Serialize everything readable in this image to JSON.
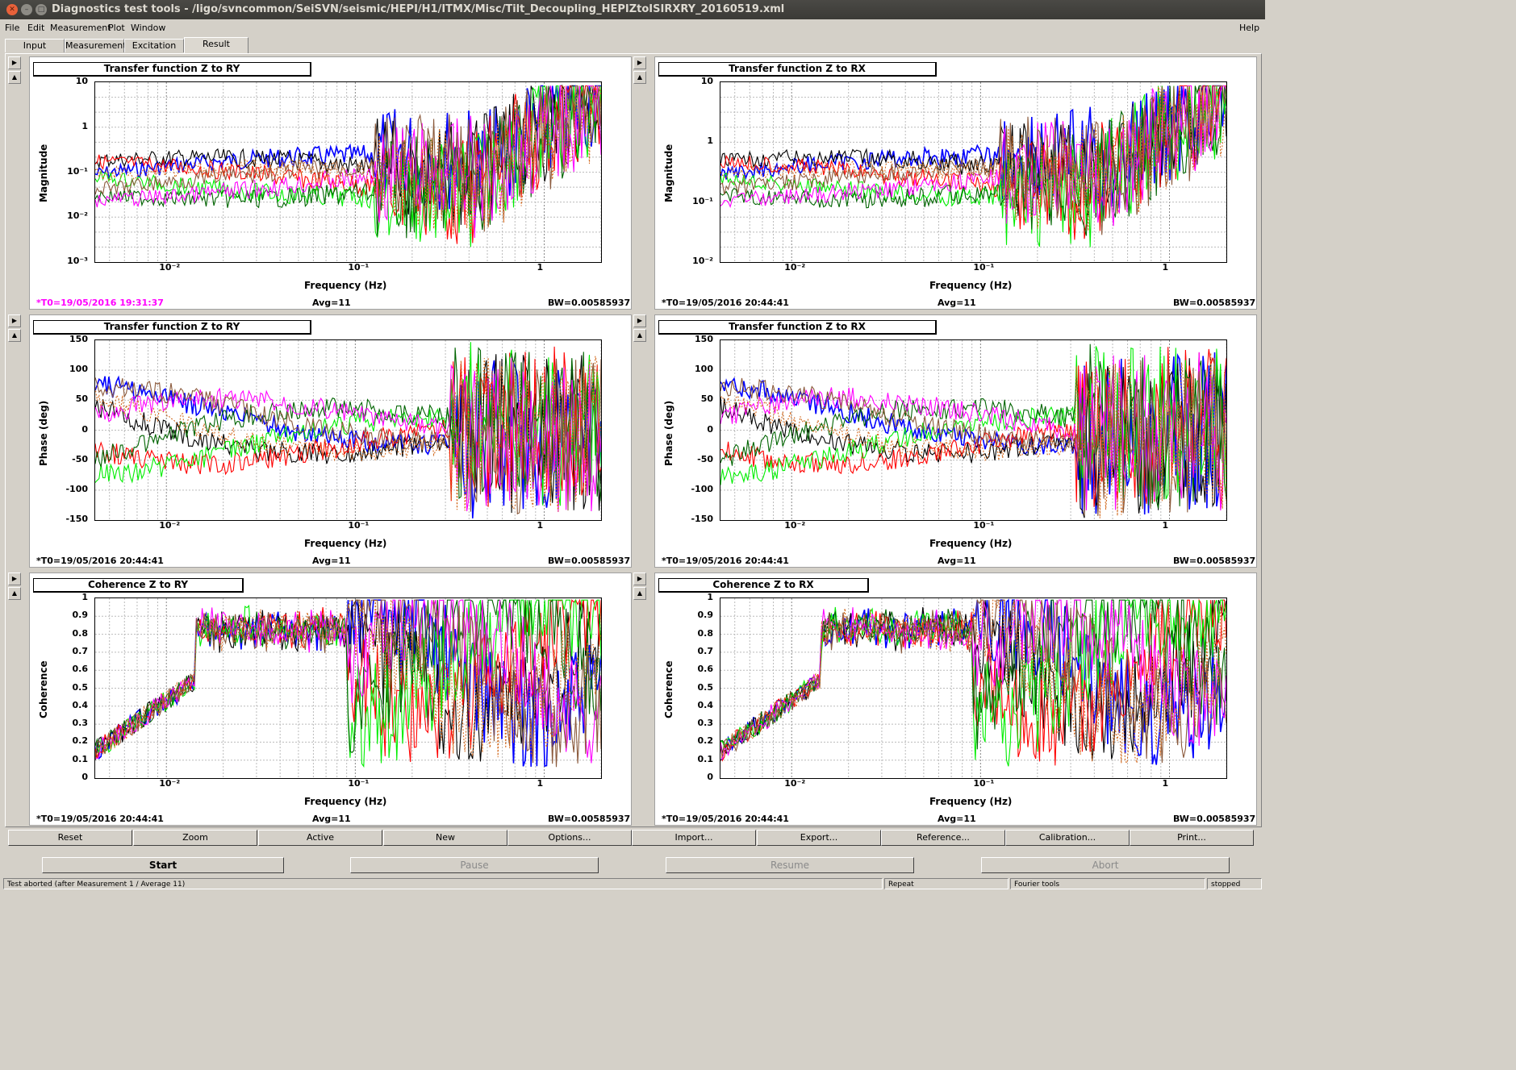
{
  "window": {
    "title": "Diagnostics test tools - /ligo/svncommon/SeiSVN/seismic/HEPI/H1/ITMX/Misc/Tilt_Decoupling_HEPIZtoISIRXRY_20160519.xml"
  },
  "menu": {
    "items": [
      "File",
      "Edit",
      "Measurement",
      "Plot",
      "Window"
    ],
    "help": "Help"
  },
  "tabs": [
    "Input",
    "Measurement",
    "Excitation",
    "Result"
  ],
  "colors": [
    "#0000ff",
    "#000000",
    "#ff0000",
    "#00ee00",
    "#006400",
    "#ff00ff",
    "#8b5a3c",
    "#d2691e"
  ],
  "panels": [
    {
      "title": "Transfer function Z to RY",
      "ylabel": "Magnitude",
      "xlabel": "Frequency (Hz)",
      "yticks": [
        "10",
        "1",
        "10⁻¹",
        "10⁻²",
        "10⁻³"
      ],
      "xticks": [
        "10⁻²",
        "10⁻¹",
        "1"
      ],
      "t0": "*T0=19/05/2016 19:31:37",
      "avg": "Avg=11",
      "bw": "BW=0.00585937"
    },
    {
      "title": "Transfer function Z to RX",
      "ylabel": "Magnitude",
      "xlabel": "Frequency (Hz)",
      "yticks": [
        "10",
        "1",
        "10⁻¹",
        "10⁻²"
      ],
      "xticks": [
        "10⁻²",
        "10⁻¹",
        "1"
      ],
      "t0": "*T0=19/05/2016 20:44:41",
      "avg": "Avg=11",
      "bw": "BW=0.00585937"
    },
    {
      "title": "Transfer function Z to RY",
      "ylabel": "Phase (deg)",
      "xlabel": "Frequency (Hz)",
      "yticks": [
        "150",
        "100",
        "50",
        "0",
        "-50",
        "-100",
        "-150"
      ],
      "xticks": [
        "10⁻²",
        "10⁻¹",
        "1"
      ],
      "t0": "*T0=19/05/2016 20:44:41",
      "avg": "Avg=11",
      "bw": "BW=0.00585937"
    },
    {
      "title": "Transfer function Z to RX",
      "ylabel": "Phase (deg)",
      "xlabel": "Frequency (Hz)",
      "yticks": [
        "150",
        "100",
        "50",
        "0",
        "-50",
        "-100",
        "-150"
      ],
      "xticks": [
        "10⁻²",
        "10⁻¹",
        "1"
      ],
      "t0": "*T0=19/05/2016 20:44:41",
      "avg": "Avg=11",
      "bw": "BW=0.00585937"
    },
    {
      "title": "Coherence Z to RY",
      "ylabel": "Coherence",
      "xlabel": "Frequency (Hz)",
      "yticks": [
        "1",
        "0.9",
        "0.8",
        "0.7",
        "0.6",
        "0.5",
        "0.4",
        "0.3",
        "0.2",
        "0.1",
        "0"
      ],
      "xticks": [
        "10⁻²",
        "10⁻¹",
        "1"
      ],
      "t0": "*T0=19/05/2016 20:44:41",
      "avg": "Avg=11",
      "bw": "BW=0.00585937"
    },
    {
      "title": "Coherence Z to RX",
      "ylabel": "Coherence",
      "xlabel": "Frequency (Hz)",
      "yticks": [
        "1",
        "0.9",
        "0.8",
        "0.7",
        "0.6",
        "0.5",
        "0.4",
        "0.3",
        "0.2",
        "0.1",
        "0"
      ],
      "xticks": [
        "10⁻²",
        "10⁻¹",
        "1"
      ],
      "t0": "*T0=19/05/2016 20:44:41",
      "avg": "Avg=11",
      "bw": "BW=0.00585937"
    }
  ],
  "toolbar": [
    "Reset",
    "Zoom",
    "Active",
    "New",
    "Options...",
    "Import...",
    "Export...",
    "Reference...",
    "Calibration...",
    "Print..."
  ],
  "controls": [
    "Start",
    "Pause",
    "Resume",
    "Abort"
  ],
  "statusbar": {
    "message": "Test aborted (after Measurement 1 / Average 11)",
    "repeat": "Repeat",
    "fourier": "Fourier tools",
    "state": "stopped"
  }
}
